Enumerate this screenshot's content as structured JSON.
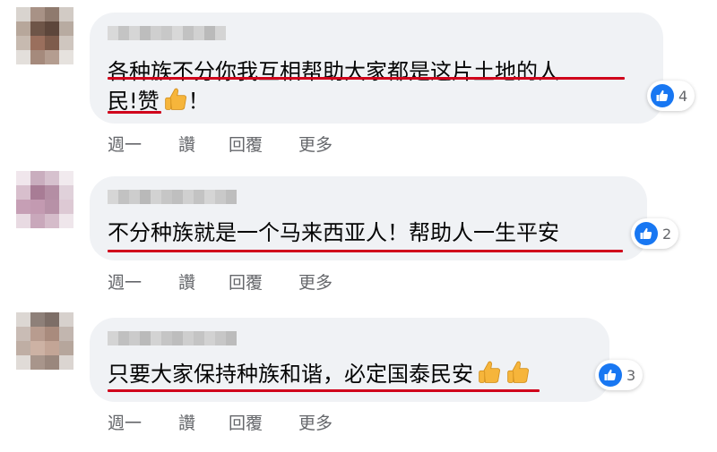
{
  "comments": [
    {
      "line1": "各种族不分你我互相帮助大家都是这片土地的人",
      "line2": "民!赞",
      "line2_suffix": "！",
      "thumbs": 1,
      "reaction_count": "4"
    },
    {
      "line1": "不分种族就是一个马来西亚人！帮助人一生平安",
      "thumbs": 0,
      "reaction_count": "2"
    },
    {
      "line1": "只要大家保持种族和谐，必定国泰民安",
      "thumbs": 2,
      "reaction_count": "3"
    }
  ],
  "actions": {
    "time": "週一",
    "like": "讚",
    "reply": "回覆",
    "more": "更多"
  },
  "colors": {
    "bubble": "#f0f2f5",
    "underline": "#d0021b",
    "like_blue": "#1877f2",
    "meta_gray": "#65676b"
  },
  "icons": [
    "like-icon",
    "thumbs-up-emoji"
  ]
}
